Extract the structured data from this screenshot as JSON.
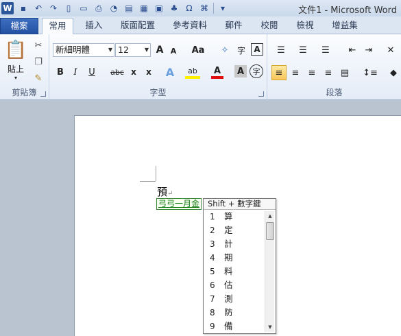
{
  "window": {
    "title": "文件1 - Microsoft Word",
    "app_letter": "W"
  },
  "quick_access": [
    "save-icon",
    "undo-icon",
    "redo-icon",
    "new-document-icon",
    "open-folder-icon",
    "print-icon",
    "print-preview-icon",
    "text-box-icon",
    "table-icon",
    "picture-icon",
    "clip-art-icon",
    "omega-symbol-icon",
    "smartart-icon",
    "customize-icon"
  ],
  "tabs": [
    "檔案",
    "常用",
    "插入",
    "版面配置",
    "參考資料",
    "郵件",
    "校閱",
    "檢視",
    "增益集"
  ],
  "ribbon": {
    "clipboard": {
      "label": "剪貼簿",
      "paste": "貼上"
    },
    "font": {
      "label": "字型",
      "font_name": "新細明體",
      "font_size": "12",
      "grow": "A",
      "shrink": "A",
      "case": "Aa",
      "bold": "B",
      "italic": "I",
      "underline": "U",
      "strike": "abc",
      "sub": "x",
      "sup": "x",
      "effects": "A",
      "highlight": "ab",
      "color": "A",
      "shade": "A",
      "enclose": "字",
      "phonetic": "字",
      "border_char": "A"
    },
    "paragraph": {
      "label": "段落"
    }
  },
  "document": {
    "typed_text": "預",
    "composition": "弓弓一月金"
  },
  "candidates": {
    "header": "Shift + 數字鍵",
    "items": [
      {
        "num": "1",
        "char": "算"
      },
      {
        "num": "2",
        "char": "定"
      },
      {
        "num": "3",
        "char": "計"
      },
      {
        "num": "4",
        "char": "期"
      },
      {
        "num": "5",
        "char": "料"
      },
      {
        "num": "6",
        "char": "估"
      },
      {
        "num": "7",
        "char": "測"
      },
      {
        "num": "8",
        "char": "防"
      },
      {
        "num": "9",
        "char": "備"
      }
    ]
  }
}
